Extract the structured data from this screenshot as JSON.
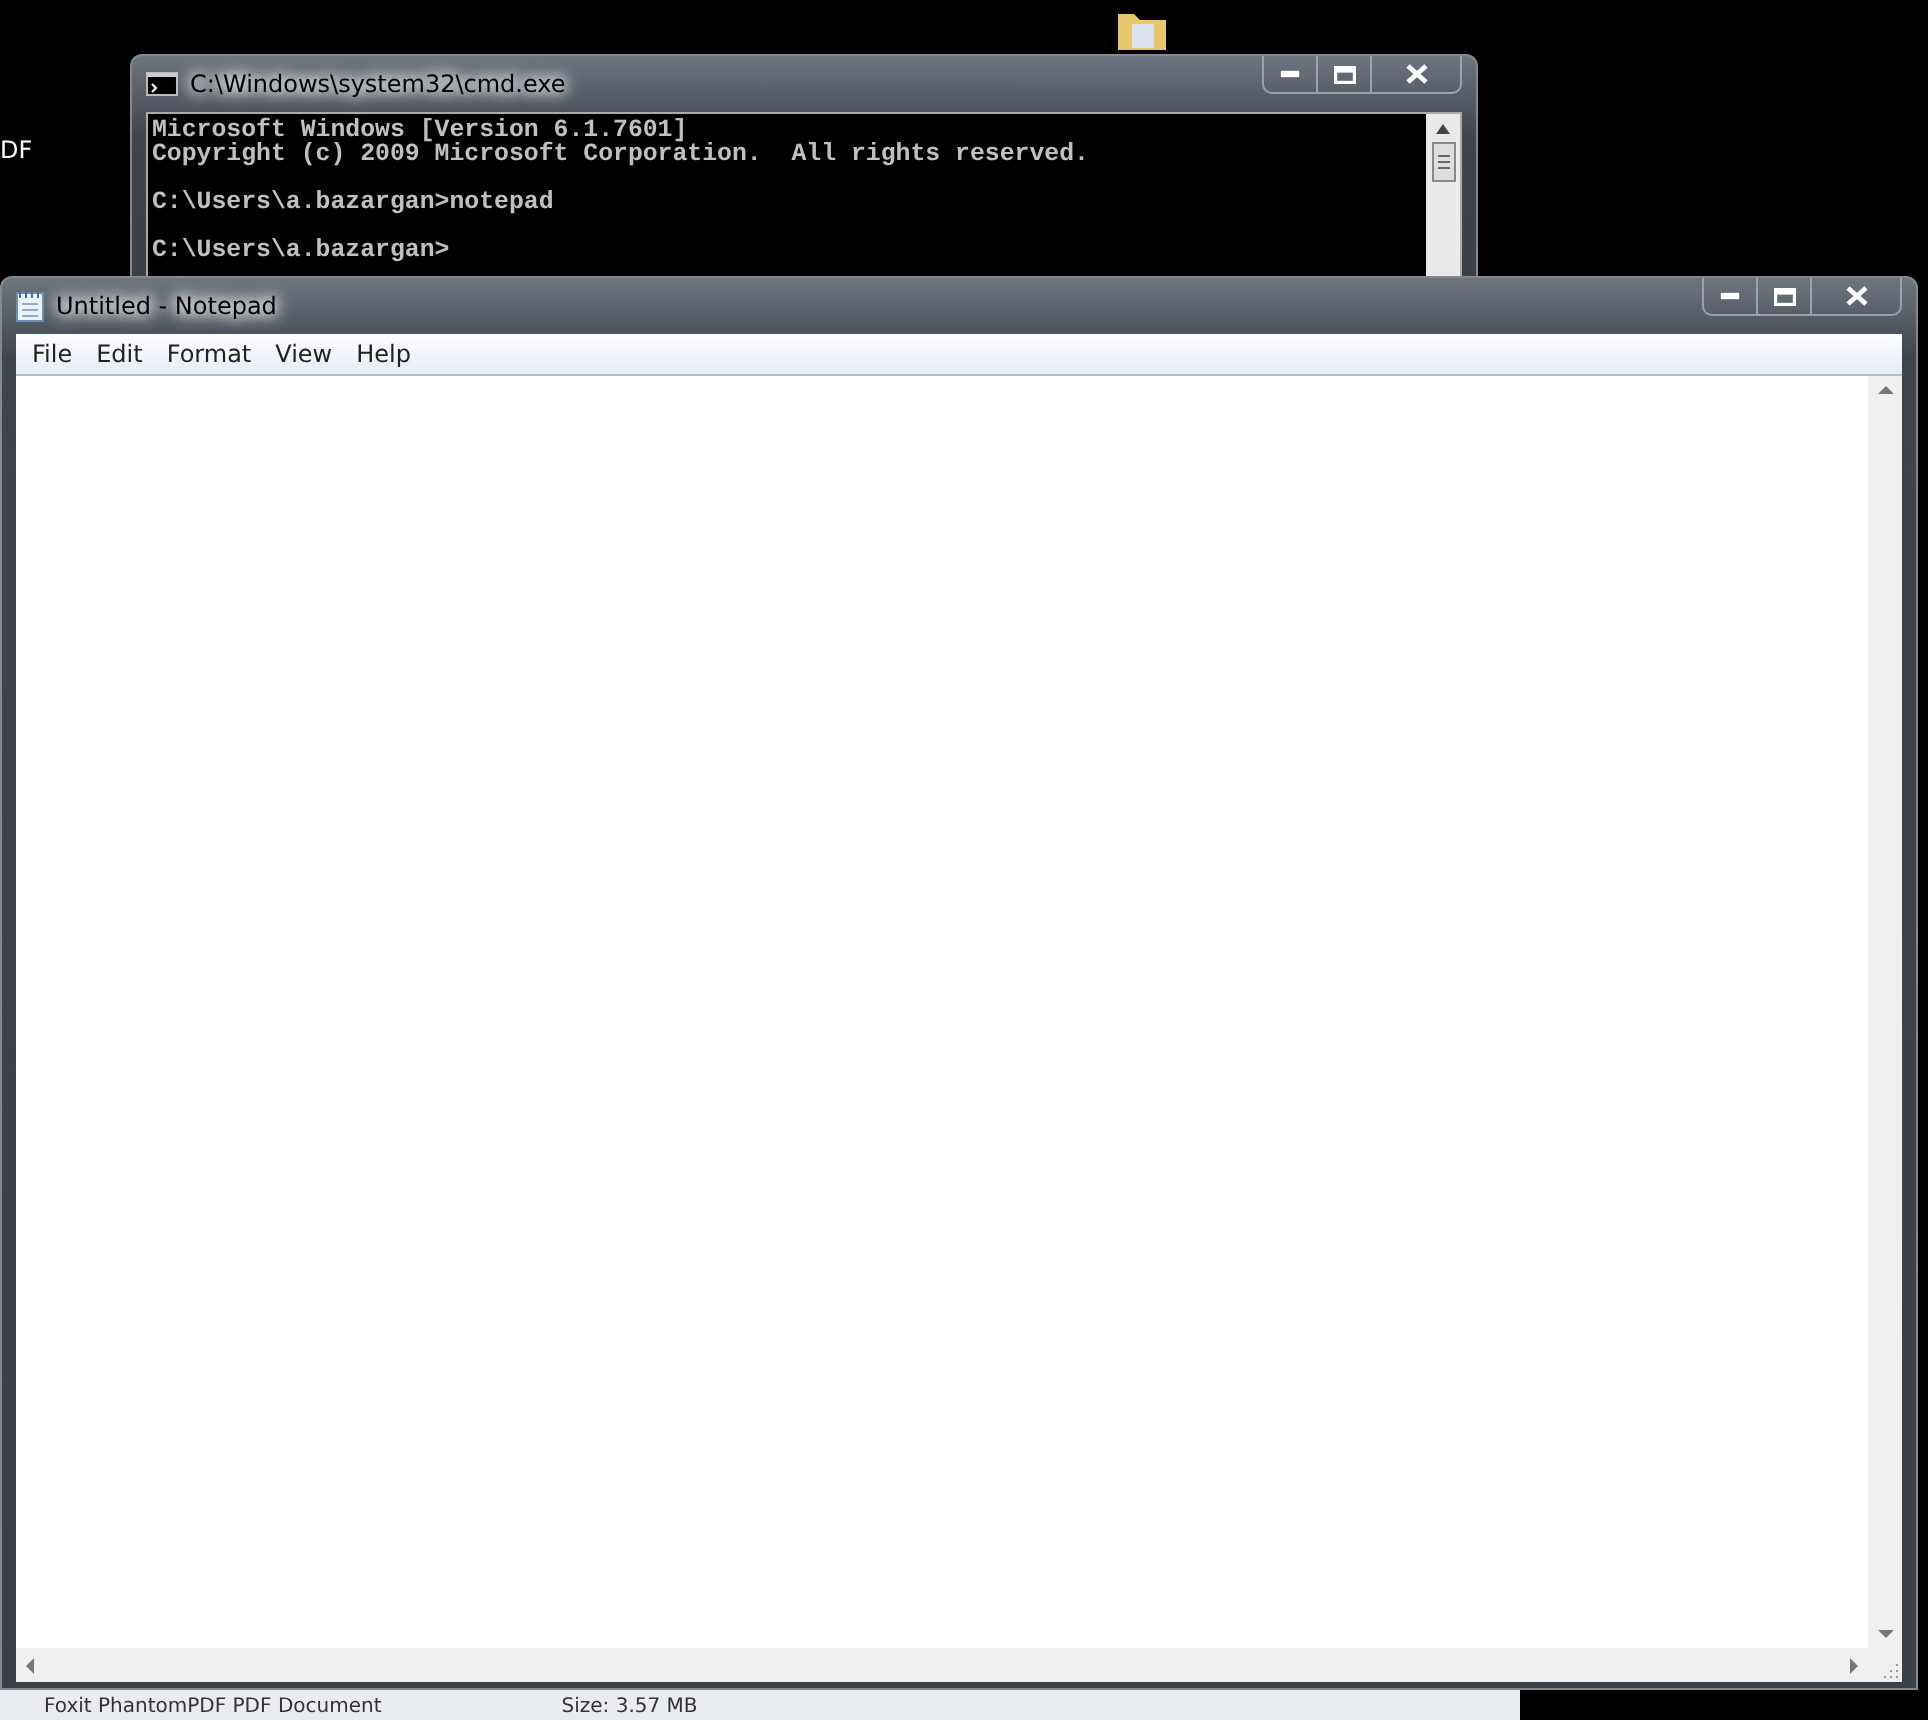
{
  "desktop": {
    "label_fragment": "DF"
  },
  "background_window": {
    "details": [
      "Foxit PhantomPDF PDF Document",
      "Size: 3.57 MB"
    ]
  },
  "cmd_window": {
    "title": "C:\\Windows\\system32\\cmd.exe",
    "paragraphs": [
      [
        "Microsoft Windows [Version 6.1.7601]",
        "Copyright (c) 2009 Microsoft Corporation.  All rights reserved."
      ],
      [
        "C:\\Users\\a.bazargan>notepad"
      ],
      [
        "C:\\Users\\a.bazargan>"
      ]
    ]
  },
  "notepad_window": {
    "title": "Untitled - Notepad",
    "menu": [
      "File",
      "Edit",
      "Format",
      "View",
      "Help"
    ]
  }
}
